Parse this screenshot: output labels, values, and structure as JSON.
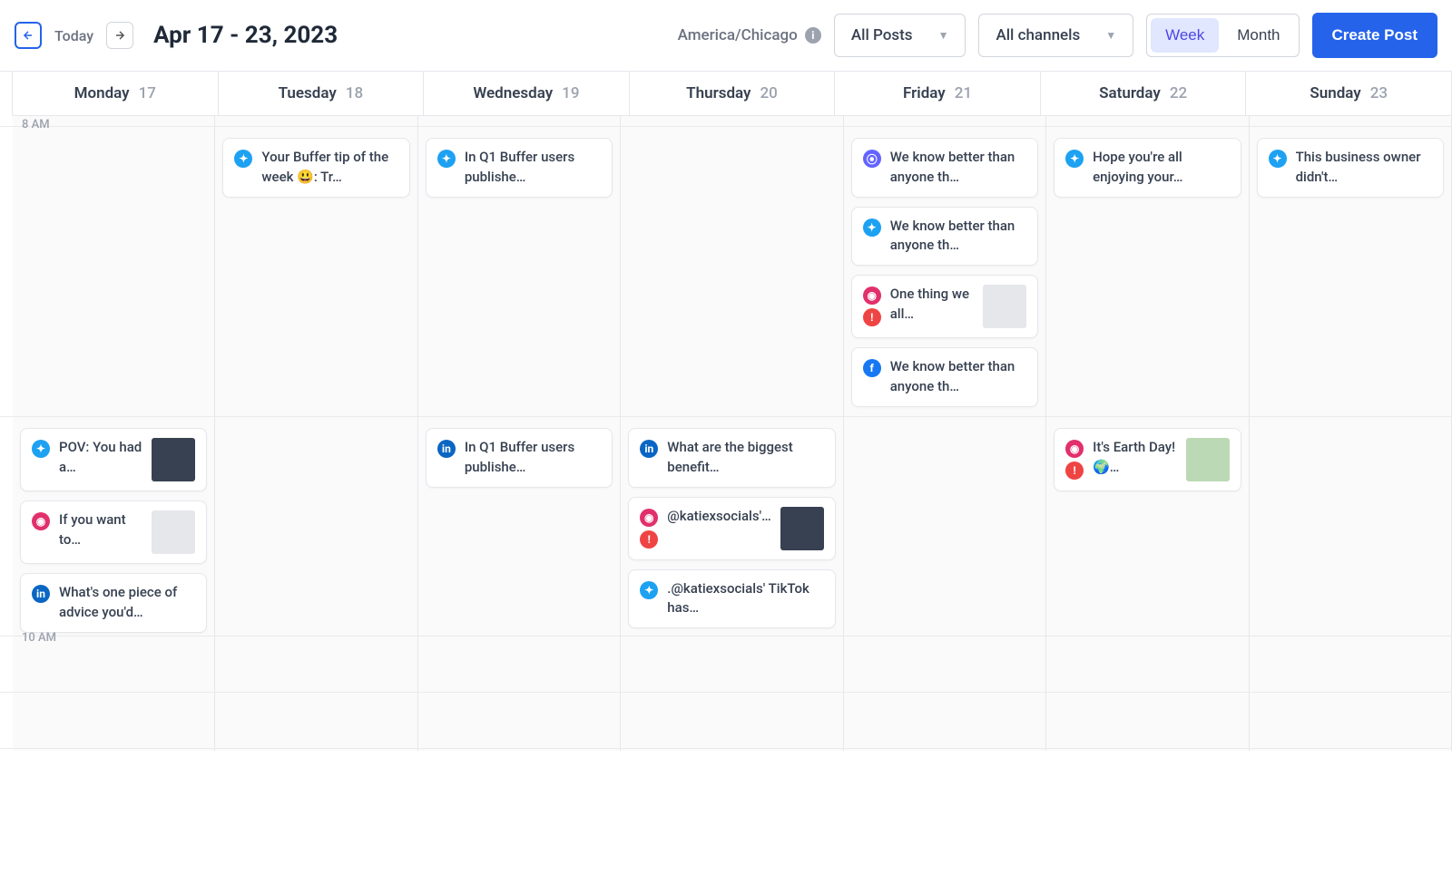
{
  "header": {
    "today_label": "Today",
    "date_range": "Apr 17 - 23, 2023",
    "timezone": "America/Chicago",
    "all_posts_label": "All Posts",
    "all_channels_label": "All channels",
    "week_label": "Week",
    "month_label": "Month",
    "create_post_label": "Create Post"
  },
  "days": [
    {
      "name": "Monday",
      "num": "17"
    },
    {
      "name": "Tuesday",
      "num": "18"
    },
    {
      "name": "Wednesday",
      "num": "19"
    },
    {
      "name": "Thursday",
      "num": "20"
    },
    {
      "name": "Friday",
      "num": "21"
    },
    {
      "name": "Saturday",
      "num": "22"
    },
    {
      "name": "Sunday",
      "num": "23"
    }
  ],
  "time_labels": {
    "t8": "8 AM",
    "t10": "10 AM"
  },
  "posts": {
    "mon_9am": [
      {
        "channels": [
          "twitter"
        ],
        "text": "POV: You had a…",
        "thumb": "dark"
      },
      {
        "channels": [
          "instagram"
        ],
        "text": "If you want to…",
        "thumb": "gray"
      },
      {
        "channels": [
          "linkedin"
        ],
        "text": "What's one piece of advice you'd…"
      }
    ],
    "tue_8am": [
      {
        "channels": [
          "twitter"
        ],
        "text": "Your Buffer tip of the week 😃: Tr…"
      }
    ],
    "wed_8am": [
      {
        "channels": [
          "twitter"
        ],
        "text": "In Q1 Buffer users publishe…"
      }
    ],
    "wed_9am": [
      {
        "channels": [
          "linkedin"
        ],
        "text": "In Q1 Buffer users publishe…"
      }
    ],
    "thu_9am": [
      {
        "channels": [
          "linkedin"
        ],
        "text": "What are the biggest benefit…"
      },
      {
        "channels": [
          "instagram",
          "alert"
        ],
        "text": "@katiexsocials'…",
        "thumb": "dark"
      },
      {
        "channels": [
          "twitter"
        ],
        "text": ".@katiexsocials' TikTok has…"
      }
    ],
    "fri_8am": [
      {
        "channels": [
          "mastodon"
        ],
        "text": "We know better than anyone th…"
      },
      {
        "channels": [
          "twitter"
        ],
        "text": "We know better than anyone th…"
      },
      {
        "channels": [
          "instagram",
          "alert"
        ],
        "text": "One thing we all…",
        "thumb": "gray"
      },
      {
        "channels": [
          "facebook"
        ],
        "text": "We know better than anyone th…"
      }
    ],
    "sat_8am": [
      {
        "channels": [
          "twitter"
        ],
        "text": "Hope you're all enjoying your…"
      }
    ],
    "sat_9am": [
      {
        "channels": [
          "instagram",
          "alert"
        ],
        "text": "It's Earth Day! 🌍…",
        "thumb": "green"
      }
    ],
    "sun_8am": [
      {
        "channels": [
          "twitter"
        ],
        "text": "This business owner didn't…"
      }
    ]
  }
}
